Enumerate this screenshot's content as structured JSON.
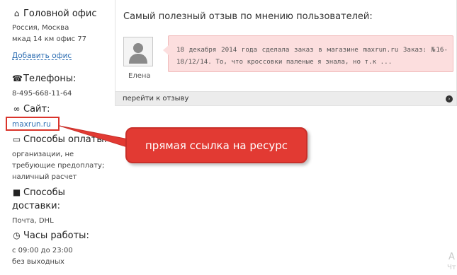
{
  "sidebar": {
    "office": {
      "title": "Головной офис",
      "address_line1": "Россия, Москва",
      "address_line2": "мкад 14 км офис 77",
      "add_office_link": "Добавить офис"
    },
    "phones": {
      "title": "Телефоны:",
      "value": "8-495-668-11-64"
    },
    "site": {
      "title": "Сайт:",
      "value": "maxrun.ru"
    },
    "payment": {
      "title": "Способы оплаты:",
      "line1": "организации, не",
      "line2": "требующие предоплату;",
      "line3": "наличный расчет"
    },
    "delivery": {
      "title_line1": "Способы",
      "title_line2": "доставки:",
      "value": "Почта, DHL"
    },
    "hours": {
      "title": "Часы работы:",
      "line1": "с 09:00 до 23:00",
      "line2": "без выходных"
    }
  },
  "review": {
    "title": "Самый полезный отзыв по мнению пользователей:",
    "author": "Елена",
    "text": "18 декабря 2014 года сделала заказ в магазине maxrun.ru Заказ: №16-18/12/14. То, что кроссовки паленые я знала, но т.к ...",
    "footer_link": "перейти к отзыву"
  },
  "annotation": {
    "callout_text": "прямая ссылка на ресурс"
  },
  "corner_text": {
    "line1": "А",
    "line2": "Чт"
  },
  "colors": {
    "link": "#2f6fb3",
    "callout": "#e23a33",
    "bubble": "#fcdede"
  }
}
